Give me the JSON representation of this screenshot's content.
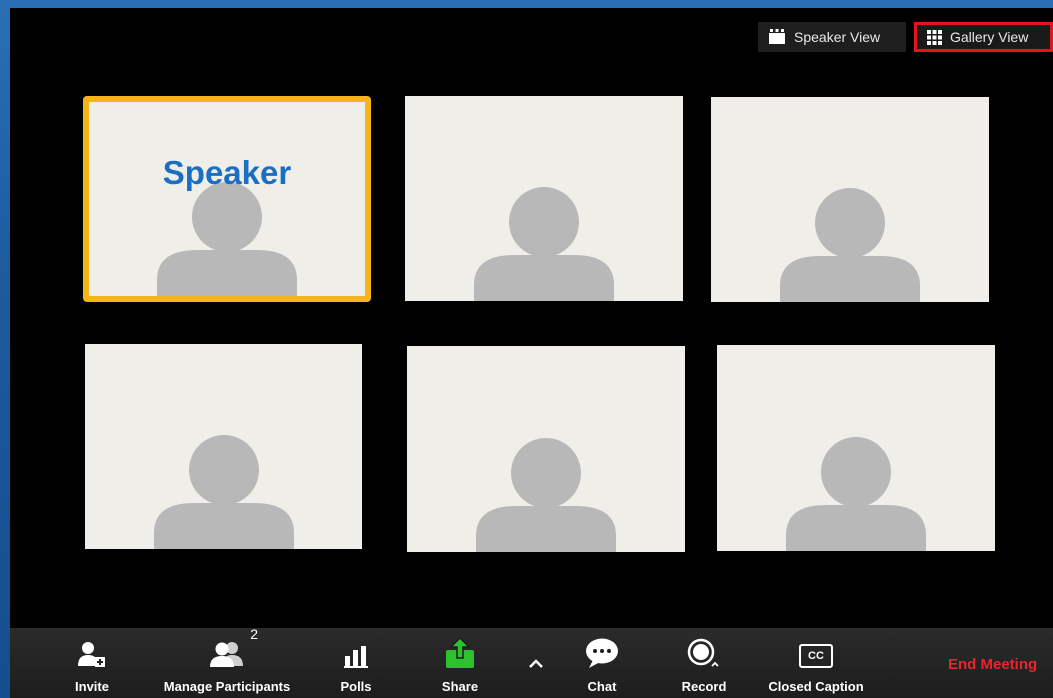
{
  "view_toggle": {
    "speaker_label": "Speaker View",
    "gallery_label": "Gallery View"
  },
  "gallery": {
    "speaker_label": "Speaker"
  },
  "toolbar": {
    "invite": "Invite",
    "manage_participants": "Manage Participants",
    "participant_count": "2",
    "polls": "Polls",
    "share": "Share",
    "chat": "Chat",
    "record": "Record",
    "closed_caption": "Closed Caption",
    "closed_caption_badge": "CC",
    "end_meeting": "End Meeting"
  },
  "colors": {
    "speaker_highlight": "#f5b519",
    "active_view_border": "#e0151d",
    "share_green": "#2dc22d",
    "end_meeting": "#e8262b"
  }
}
